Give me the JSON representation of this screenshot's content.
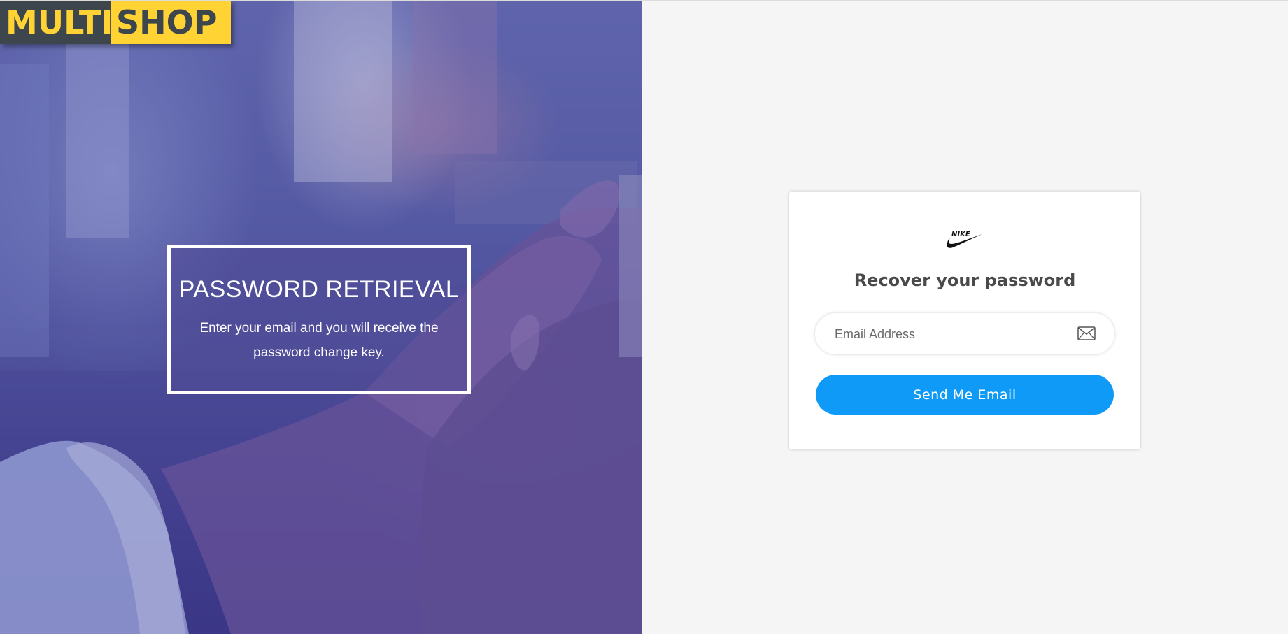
{
  "logo": {
    "part1": "MULTI",
    "part2": "SHOP"
  },
  "hero": {
    "title": "PASSWORD RETRIEVAL",
    "text": "Enter your email and you will receive the password change key."
  },
  "card": {
    "brand_icon": "nike-swoosh-icon",
    "brand_text": "NIKE",
    "title": "Recover your password",
    "email": {
      "placeholder": "Email Address",
      "value": "",
      "icon": "envelope-icon"
    },
    "submit_label": "Send Me Email"
  },
  "colors": {
    "logo_dark": "#3d464d",
    "logo_yellow": "#ffd333",
    "button_blue": "#0e9af6",
    "page_bg": "#f5f5f5",
    "hero_tint": "#4e4f98"
  }
}
